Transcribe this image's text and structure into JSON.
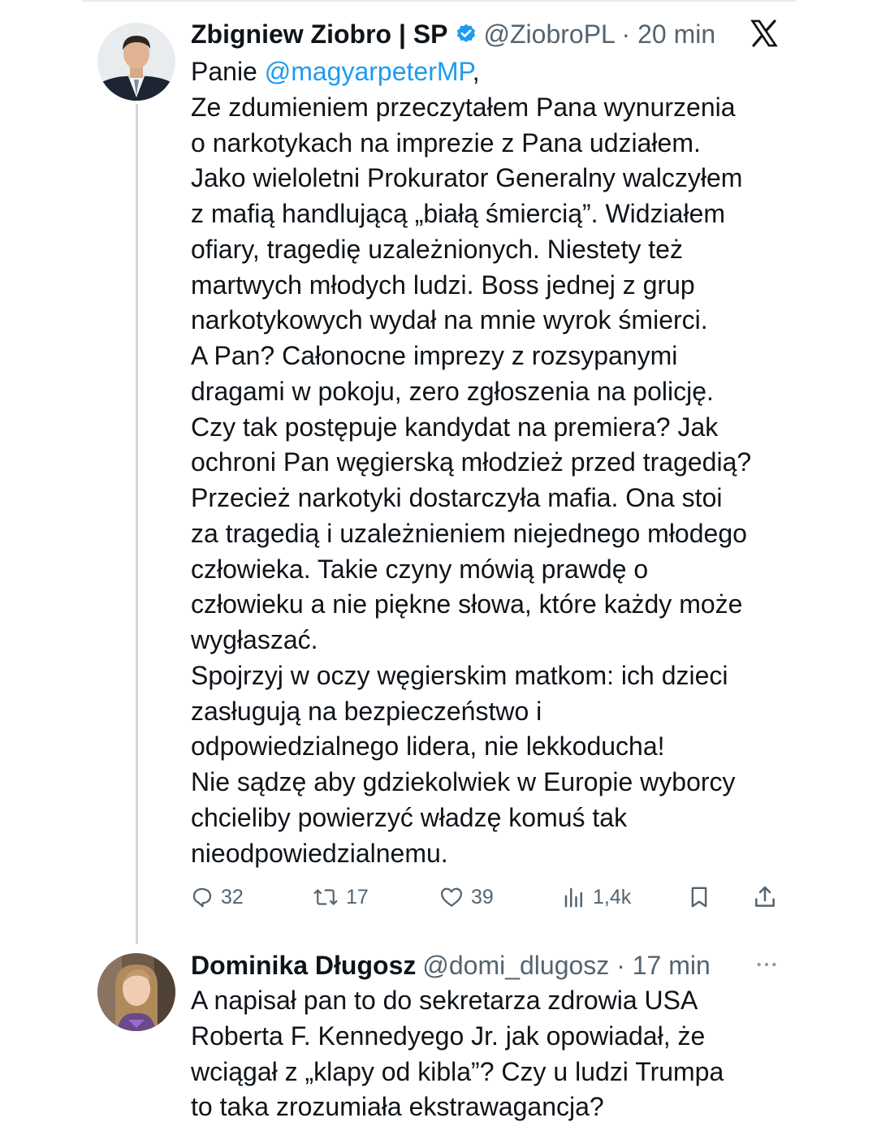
{
  "colors": {
    "text": "#0f1419",
    "secondary": "#536471",
    "link": "#1d9bf0",
    "verified": "#1d9bf0",
    "thread_line": "#cfd9de"
  },
  "tweet1": {
    "author_name": "Zbigniew Ziobro | SP",
    "handle_time": "@ZiobroPL · 20 min",
    "body": {
      "greeting_prefix": "Panie ",
      "mention": "@magyarpeterMP",
      "greeting_suffix": ",",
      "lines": [
        "Ze zdumieniem przeczytałem Pana wynurzenia",
        "o narkotykach na imprezie z Pana udziałem.",
        "Jako wieloletni Prokurator Generalny walczyłem",
        "z mafią handlującą „białą śmiercią”. Widziałem",
        "ofiary, tragedię uzależnionych. Niestety też",
        "martwych młodych ludzi. Boss jednej z grup",
        "narkotykowych wydał na mnie wyrok śmierci.",
        "A Pan? Całonocne imprezy z rozsypanymi",
        "dragami w pokoju, zero zgłoszenia na policję.",
        "Czy tak postępuje kandydat na premiera? Jak",
        "ochroni Pan węgierską młodzież przed tragedią?",
        "Przecież narkotyki dostarczyła mafia. Ona stoi",
        "za tragedią i uzależnieniem niejednego młodego",
        "człowieka. Takie czyny mówią prawdę o",
        "człowieku a nie piękne słowa, które każdy może",
        "wygłaszać.",
        "Spojrzyj w oczy węgierskim matkom: ich dzieci",
        "zasługują na bezpieczeństwo i",
        "odpowiedzialnego lidera, nie lekkoducha!",
        "Nie sądzę aby gdziekolwiek w Europie wyborcy",
        "chcieliby  powierzyć władzę komuś tak",
        "nieodpowiedzialnemu."
      ]
    },
    "actions": {
      "replies": "32",
      "retweets": "17",
      "likes": "39",
      "views": "1,4k"
    }
  },
  "tweet2": {
    "author_name": "Dominika Długosz",
    "handle_time": "@domi_dlugosz · 17 min",
    "body": {
      "lines": [
        "A napisał pan to do sekretarza zdrowia USA",
        "Roberta F. Kennedyego Jr. jak opowiadał, że",
        "wciągał z „klapy od kibla”? Czy u ludzi Trumpa",
        "to taka zrozumiała ekstrawagancja?"
      ]
    }
  },
  "icons": {
    "verified": "verified-badge-icon",
    "x_logo": "x-logo-icon",
    "reply": "reply-icon",
    "retweet": "retweet-icon",
    "like": "heart-icon",
    "views": "views-icon",
    "bookmark": "bookmark-icon",
    "share": "share-icon",
    "more": "more-icon"
  }
}
